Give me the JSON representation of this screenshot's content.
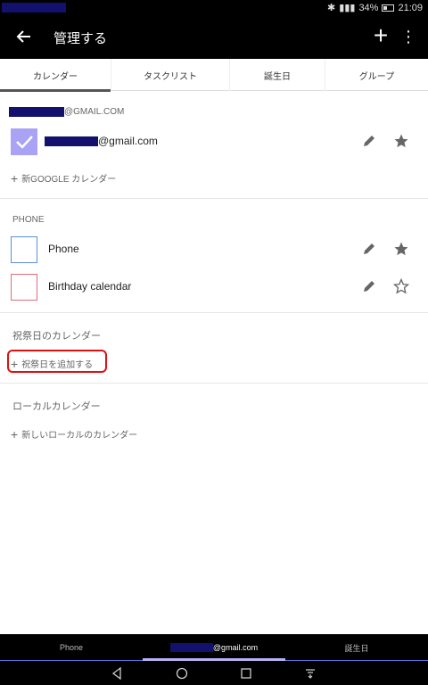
{
  "status": {
    "battery": "34%",
    "time": "21:09"
  },
  "appbar": {
    "title": "管理する",
    "back_icon": "arrow-back-icon",
    "add_icon": "plus-icon",
    "more_icon": "more-vert-icon"
  },
  "tabs": [
    {
      "label": "カレンダー",
      "active": true
    },
    {
      "label": "タスクリスト",
      "active": false
    },
    {
      "label": "誕生日",
      "active": false
    },
    {
      "label": "グループ",
      "active": false
    }
  ],
  "google_section": {
    "account_suffix": "@GMAIL.COM",
    "calendar_suffix": "@gmail.com",
    "add_label": "新GOOGLE カレンダー",
    "check_color": "#a9a2f5"
  },
  "phone_section": {
    "title": "PHONE",
    "items": [
      {
        "label": "Phone",
        "color": "#5b8fd8",
        "starred": true
      },
      {
        "label": "Birthday calendar",
        "color": "#e06d77",
        "starred": false
      }
    ]
  },
  "holiday_section": {
    "title": "祝祭日のカレンダー",
    "add_label": "祝祭日を追加する"
  },
  "local_section": {
    "title": "ローカルカレンダー",
    "add_label": "新しいローカルのカレンダー"
  },
  "bottom_tabs": [
    {
      "label": "Phone",
      "active": false
    },
    {
      "label": "@gmail.com",
      "active": true
    },
    {
      "label": "誕生日",
      "active": false
    }
  ]
}
